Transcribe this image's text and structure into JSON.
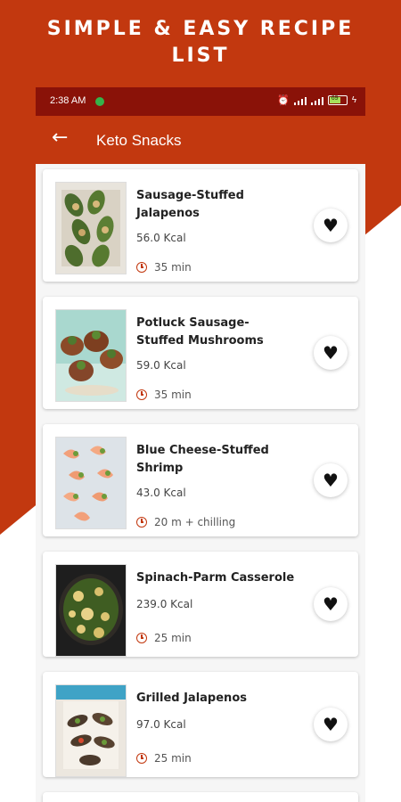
{
  "banner": {
    "line1": "SIMPLE & EASY RECIPE",
    "line2": "LIST"
  },
  "status": {
    "time": "2:38 AM",
    "battery": "69"
  },
  "appbar": {
    "back_icon": "←",
    "title": "Keto Snacks"
  },
  "favorite_icon": "♥",
  "recipes": [
    {
      "name": "Sausage-Stuffed Jalapenos",
      "kcal": "56.0 Kcal",
      "time": "35 min"
    },
    {
      "name": "Potluck Sausage-Stuffed Mushrooms",
      "kcal": "59.0 Kcal",
      "time": "35 min"
    },
    {
      "name": "Blue Cheese-Stuffed Shrimp",
      "kcal": "43.0 Kcal",
      "time": "20 m + chilling"
    },
    {
      "name": "Spinach-Parm Casserole",
      "kcal": "239.0 Kcal",
      "time": "25 min"
    },
    {
      "name": "Grilled Jalapenos",
      "kcal": "97.0 Kcal",
      "time": "25 min"
    }
  ],
  "colors": {
    "accent": "#c2380f",
    "statusbar": "#8a1208"
  }
}
